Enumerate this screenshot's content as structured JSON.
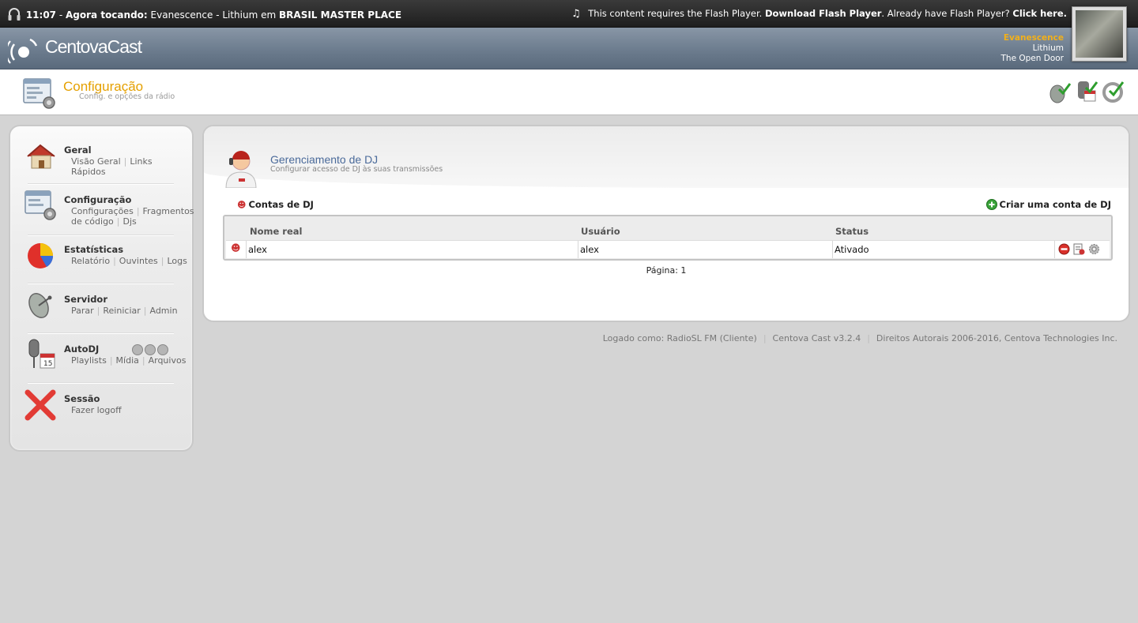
{
  "topbar": {
    "time": "11:07",
    "now_playing_label": "Agora tocando:",
    "now_playing_track": "Evanescence - Lithium em",
    "station": "BRASIL MASTER PLACE",
    "flash_text": "This content requires the Flash Player.",
    "flash_download": "Download Flash Player",
    "flash_already": "Already have Flash Player?",
    "flash_click": "Click here."
  },
  "header": {
    "logo_text": "CentovaCast",
    "artist": "Evanescence",
    "song": "Lithium",
    "album": "The Open Door"
  },
  "page": {
    "title": "Configuração",
    "subtitle": "Config. e opções da rádio"
  },
  "sidebar": {
    "items": [
      {
        "title": "Geral",
        "links": [
          "Visão Geral",
          "Links Rápidos"
        ]
      },
      {
        "title": "Configuração",
        "links": [
          "Configurações",
          "Fragmentos de código",
          "Djs"
        ]
      },
      {
        "title": "Estatísticas",
        "links": [
          "Relatório",
          "Ouvintes",
          "Logs"
        ]
      },
      {
        "title": "Servidor",
        "links": [
          "Parar",
          "Reiniciar",
          "Admin"
        ]
      },
      {
        "title": "AutoDJ",
        "links": [
          "Playlists",
          "Mídia",
          "Arquivos"
        ]
      },
      {
        "title": "Sessão",
        "links": [
          "Fazer logoff"
        ]
      }
    ]
  },
  "main": {
    "title": "Gerenciamento de DJ",
    "subtitle": "Configurar acesso de DJ às suas transmissões",
    "section_label": "Contas de DJ",
    "create_label": "Criar uma conta de DJ",
    "columns": [
      "Nome real",
      "Usuário",
      "Status"
    ],
    "rows": [
      {
        "nome": "alex",
        "usuario": "alex",
        "status": "Ativado"
      }
    ],
    "pagination": "Página: 1"
  },
  "footer": {
    "logged": "Logado como: RadioSL FM (Cliente)",
    "version": "Centova Cast v3.2.4",
    "copyright": "Direitos Autorais 2006-2016, Centova Technologies Inc."
  },
  "colors": {
    "accent": "#e5a000",
    "title_blue": "#4a6a9a",
    "artist": "#f2b01a"
  }
}
